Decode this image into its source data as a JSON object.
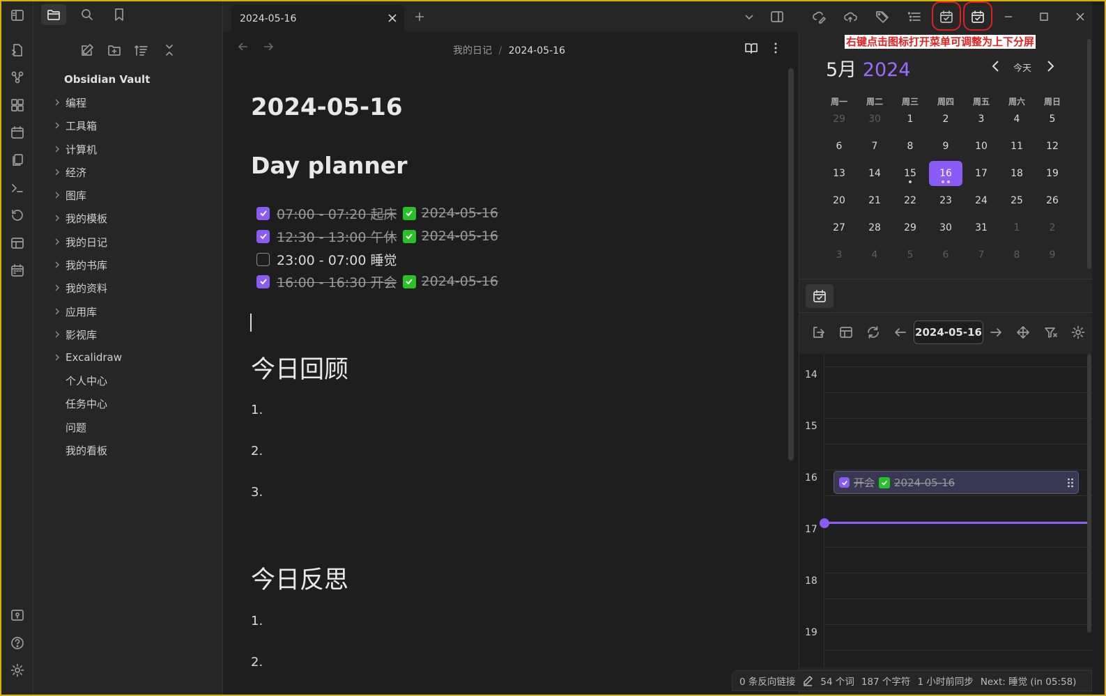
{
  "window": {
    "active_tab": "2024-05-16"
  },
  "sidebar": {
    "vault_name": "Obsidian Vault",
    "folders": [
      "编程",
      "工具箱",
      "计算机",
      "经济",
      "图库",
      "我的模板",
      "我的日记",
      "我的书库",
      "我的资料",
      "应用库",
      "影视库",
      "Excalidraw"
    ],
    "files": [
      "个人中心",
      "任务中心",
      "问题",
      "我的看板"
    ]
  },
  "editor": {
    "breadcrumb_parent": "我的日记",
    "breadcrumb_sep": "/",
    "breadcrumb_current": "2024-05-16",
    "title": "2024-05-16",
    "h_day_planner": "Day planner",
    "tasks": [
      {
        "text": "07:00 - 07:20 起床",
        "date": "2024-05-16",
        "done": true
      },
      {
        "text": "12:30 - 13:00 午休",
        "date": "2024-05-16",
        "done": true
      },
      {
        "text": "23:00 - 07:00 睡觉",
        "date": "",
        "done": false
      },
      {
        "text": "16:00 - 16:30 开会",
        "date": "2024-05-16",
        "done": true
      }
    ],
    "h_review": "今日回顾",
    "review_items": [
      "1.",
      "2.",
      "3."
    ],
    "h_reflect": "今日反思",
    "reflect_items": [
      "1.",
      "2."
    ]
  },
  "calendar": {
    "month": "5月",
    "year": "2024",
    "today_label": "今天",
    "weekdays": [
      "周一",
      "周二",
      "周三",
      "周四",
      "周五",
      "周六",
      "周日"
    ],
    "weeks": [
      [
        "29",
        "30",
        "1",
        "2",
        "3",
        "4",
        "5"
      ],
      [
        "6",
        "7",
        "8",
        "9",
        "10",
        "11",
        "12"
      ],
      [
        "13",
        "14",
        "15",
        "16",
        "17",
        "18",
        "19"
      ],
      [
        "20",
        "21",
        "22",
        "23",
        "24",
        "25",
        "26"
      ],
      [
        "27",
        "28",
        "29",
        "30",
        "31",
        "1",
        "2"
      ],
      [
        "3",
        "4",
        "5",
        "6",
        "7",
        "8",
        "9"
      ]
    ],
    "selected_day": "16"
  },
  "planner": {
    "date": "2024-05-16",
    "hours": [
      "14",
      "15",
      "16",
      "17",
      "18",
      "19"
    ],
    "event_text": "开会",
    "event_date": "2024-05-16"
  },
  "annotation_text": "右键点击图标打开菜单可调整为上下分屏",
  "status": {
    "backlinks": "0 条反向链接",
    "words": "54 个词",
    "chars": "187 个字符",
    "sync": "1 小时前同步",
    "next": "Next: 睡觉 (in 05:58)"
  },
  "colors": {
    "accent": "#8a5cf5",
    "check_green": "#28c228",
    "annotation_red": "#e02020"
  }
}
